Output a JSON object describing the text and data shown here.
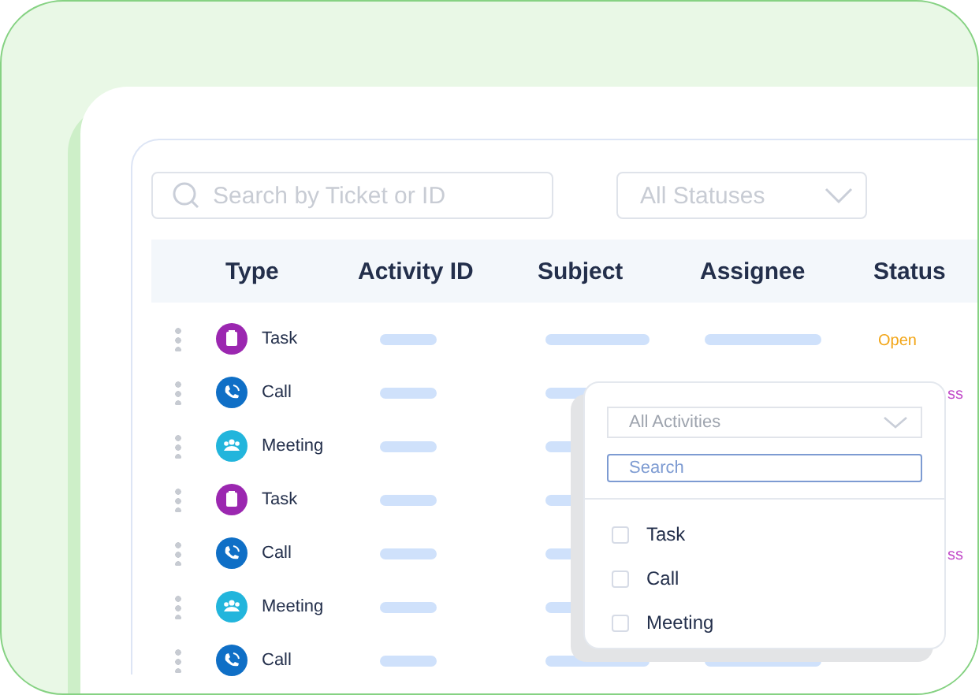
{
  "search": {
    "placeholder": "Search by Ticket or ID"
  },
  "status_filter": {
    "placeholder": "All Statuses"
  },
  "table": {
    "columns": [
      "Type",
      "Activity ID",
      "Subject",
      "Assignee",
      "Status"
    ],
    "rows": [
      {
        "type": {
          "kind": "task",
          "label": "Task"
        },
        "status": {
          "text": "Open",
          "color": "#f2a516"
        }
      },
      {
        "type": {
          "kind": "call",
          "label": "Call"
        },
        "status": {
          "text": "ss",
          "color": "#c24ac9",
          "kind": "tail"
        }
      },
      {
        "type": {
          "kind": "meeting",
          "label": "Meeting"
        }
      },
      {
        "type": {
          "kind": "task",
          "label": "Task"
        }
      },
      {
        "type": {
          "kind": "call",
          "label": "Call"
        },
        "status": {
          "text": "ss",
          "color": "#c24ac9",
          "kind": "tail"
        }
      },
      {
        "type": {
          "kind": "meeting",
          "label": "Meeting"
        }
      },
      {
        "type": {
          "kind": "call",
          "label": "Call"
        }
      }
    ]
  },
  "filter_popup": {
    "select": {
      "placeholder": "All Activities"
    },
    "search": {
      "placeholder": "Search"
    },
    "options": [
      {
        "label": "Task",
        "checked": false
      },
      {
        "label": "Call",
        "checked": false
      },
      {
        "label": "Meeting",
        "checked": false
      }
    ]
  }
}
